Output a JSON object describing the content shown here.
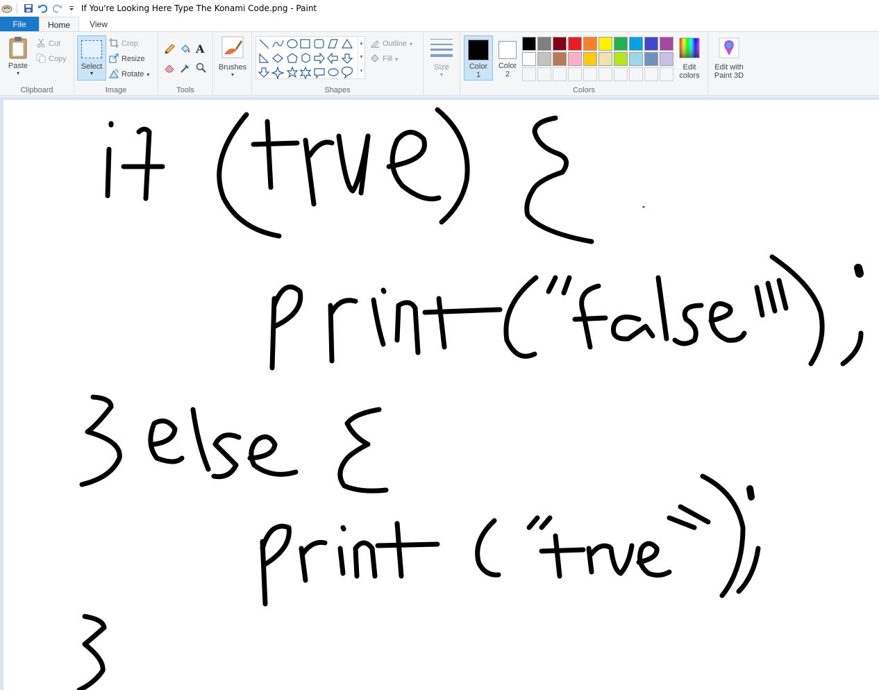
{
  "window": {
    "title": "If You're Looking Here Type The Konami Code.png - Paint"
  },
  "tabs": [
    {
      "label": "File"
    },
    {
      "label": "Home"
    },
    {
      "label": "View"
    }
  ],
  "ribbon": {
    "clipboard": {
      "paste": "Paste",
      "cut": "Cut",
      "copy": "Copy",
      "group": "Clipboard"
    },
    "image": {
      "select": "Select",
      "crop": "Crop",
      "resize": "Resize",
      "rotate": "Rotate",
      "group": "Image"
    },
    "tools": {
      "group": "Tools"
    },
    "brushes": {
      "label": "Brushes"
    },
    "shapes": {
      "outline": "Outline",
      "fill": "Fill",
      "group": "Shapes"
    },
    "size": {
      "label": "Size"
    },
    "colors": {
      "color1": "Color",
      "color1_num": "1",
      "color2": "Color",
      "color2_num": "2",
      "edit_colors_1": "Edit",
      "edit_colors_2": "colors",
      "paint3d_1": "Edit with",
      "paint3d_2": "Paint 3D",
      "group": "Colors",
      "color1_value": "#000000",
      "color2_value": "#ffffff",
      "palette_row1": [
        "#000000",
        "#7f7f7f",
        "#880015",
        "#ed1c24",
        "#ff7f27",
        "#fff200",
        "#22b14c",
        "#00a2e8",
        "#3f48cc",
        "#a349a4"
      ],
      "palette_row2": [
        "#ffffff",
        "#c3c3c3",
        "#b97a57",
        "#ffaec9",
        "#ffc90e",
        "#efe4b0",
        "#b5e61d",
        "#99d9ea",
        "#7092be",
        "#c8bfe7"
      ]
    }
  }
}
